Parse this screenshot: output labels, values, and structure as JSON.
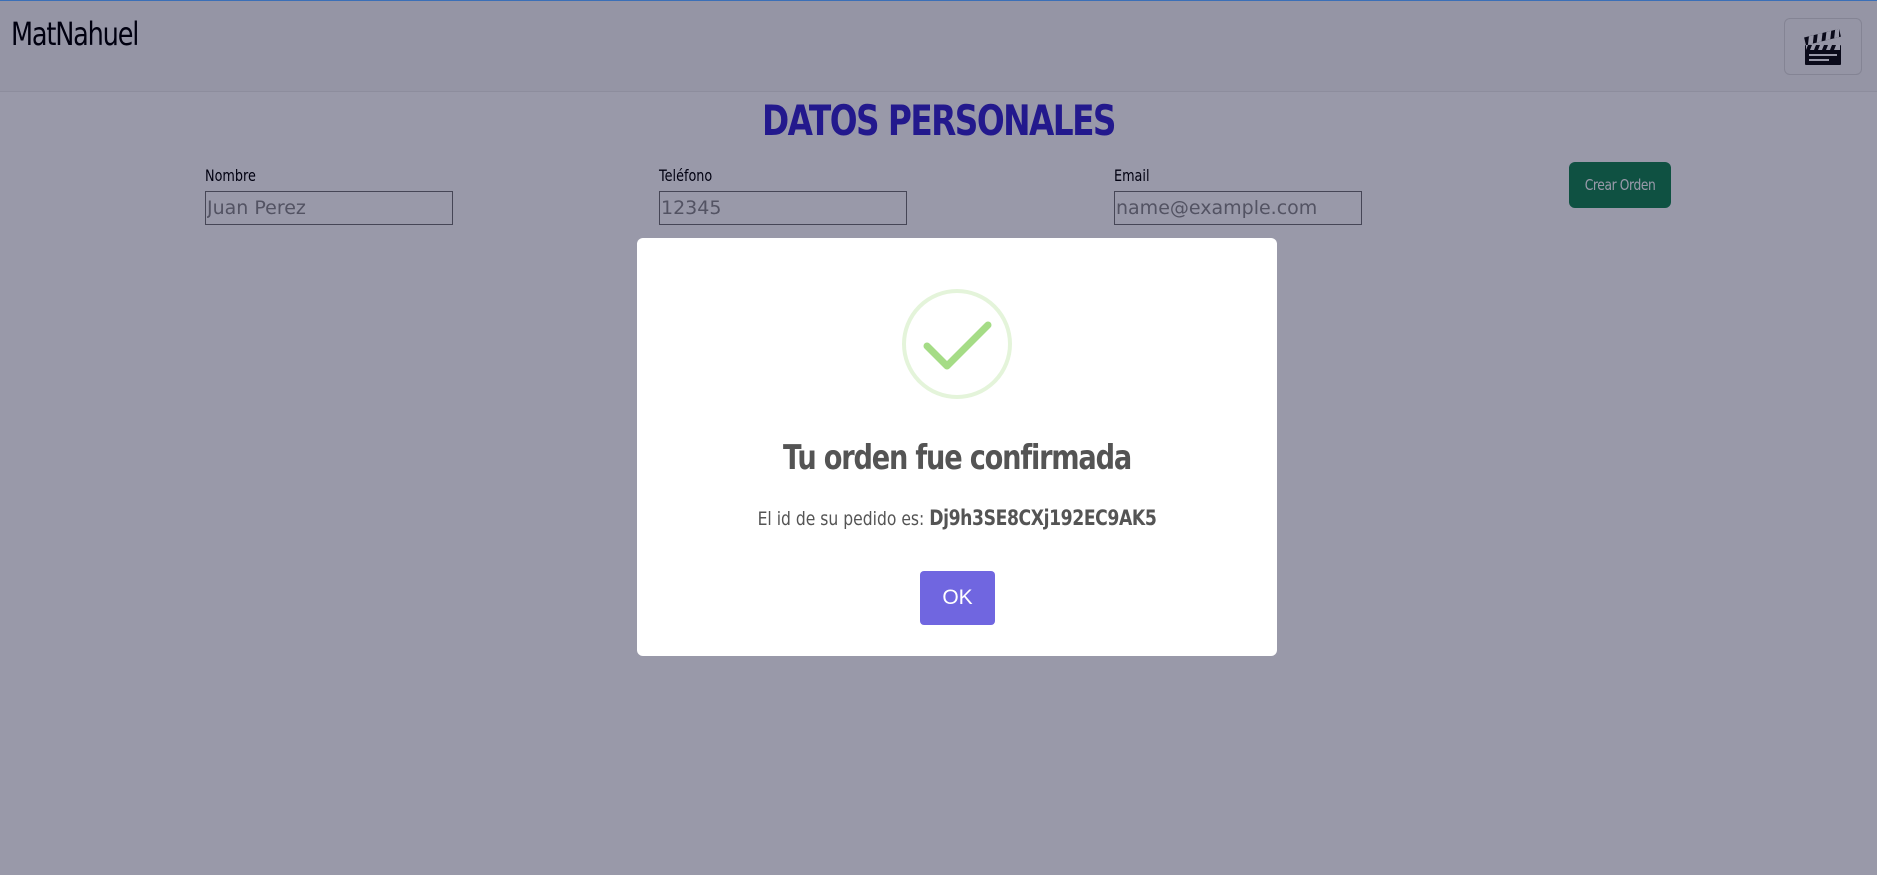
{
  "navbar": {
    "brand": "MatNahuel",
    "menu_icon": "clapperboard-icon"
  },
  "form": {
    "title": "DATOS PERSONALES",
    "fields": [
      {
        "label": "Nombre",
        "placeholder": "Juan Perez",
        "value": ""
      },
      {
        "label": "Teléfono",
        "placeholder": "12345",
        "value": ""
      },
      {
        "label": "Email",
        "placeholder": "name@example.com",
        "value": ""
      }
    ],
    "submit_label": "Crear Orden",
    "submit_color": "#198754"
  },
  "modal": {
    "icon": "success-check-icon",
    "icon_color": "#a5dc86",
    "title": "Tu orden fue confirmada",
    "text_prefix": "El id de su pedido es: ",
    "order_id": "Dj9h3SE8CXj192EC9AK5",
    "ok_label": "OK",
    "ok_color": "#7066e0"
  },
  "colors": {
    "title": "#3b2ad0",
    "overlay": "rgba(0,0,40,0.4)"
  }
}
